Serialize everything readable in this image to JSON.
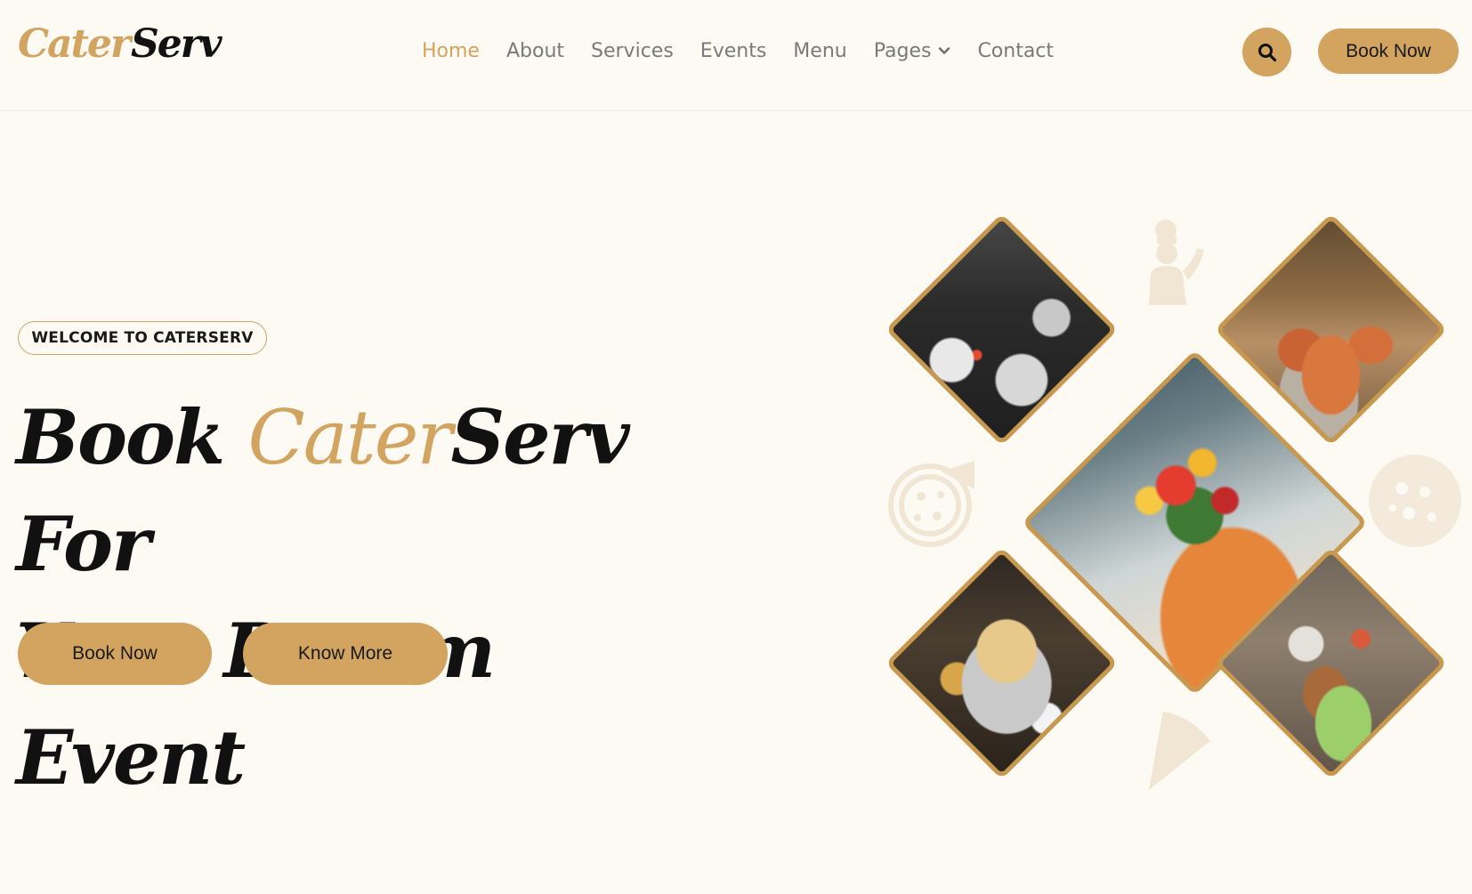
{
  "brand": {
    "logo_part1": "Cater",
    "logo_part2": "Serv"
  },
  "nav": {
    "items": [
      {
        "label": "Home",
        "active": true
      },
      {
        "label": "About"
      },
      {
        "label": "Services"
      },
      {
        "label": "Events"
      },
      {
        "label": "Menu"
      },
      {
        "label": "Pages",
        "has_dropdown": true
      },
      {
        "label": "Contact"
      }
    ]
  },
  "header": {
    "search_icon": "search-icon",
    "book_label": "Book Now"
  },
  "hero": {
    "badge": "WELCOME TO CATERSERV",
    "title_word1": "Book",
    "title_cater": "Cater",
    "title_serv": "Serv",
    "title_for": "For",
    "title_line2": "Your Dream Event",
    "book_label": "Book Now",
    "more_label": "Know More"
  },
  "colors": {
    "accent": "#d2a45f",
    "background": "#fdfaf4",
    "text_dark": "#111111",
    "nav_text": "#7a7a7a"
  }
}
